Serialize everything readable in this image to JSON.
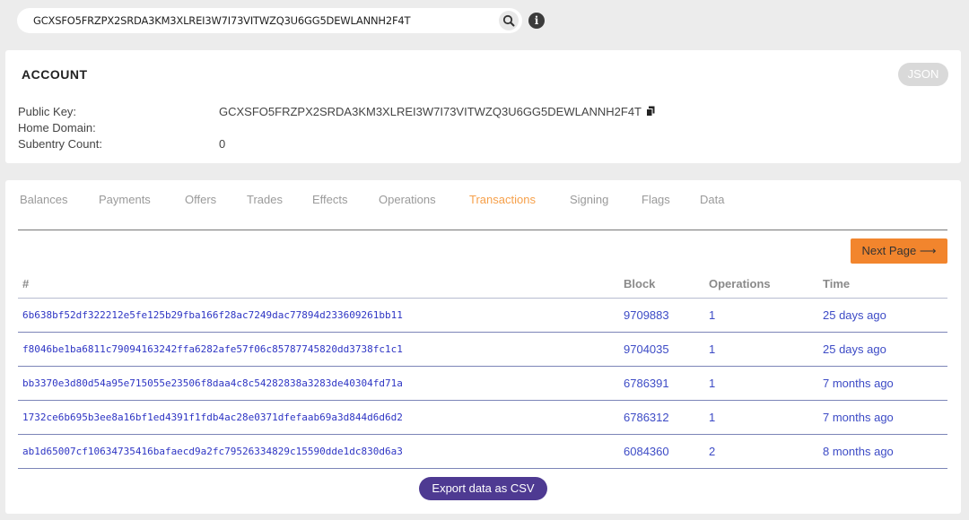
{
  "search": {
    "value": "GCXSFO5FRZPX2SRDA3KM3XLREI3W7I73VITWZQ3U6GG5DEWLANNH2F4T",
    "icon": "search-icon"
  },
  "account": {
    "title": "ACCOUNT",
    "json_label": "JSON",
    "public_key_label": "Public Key:",
    "public_key_value": "GCXSFO5FRZPX2SRDA3KM3XLREI3W7I73VITWZQ3U6GG5DEWLANNH2F4T",
    "home_domain_label": "Home Domain:",
    "home_domain_value": "",
    "subentry_label": "Subentry Count:",
    "subentry_value": "0"
  },
  "tabs": [
    {
      "label": "Balances"
    },
    {
      "label": "Payments"
    },
    {
      "label": "Offers"
    },
    {
      "label": "Trades"
    },
    {
      "label": "Effects"
    },
    {
      "label": "Operations"
    },
    {
      "label": "Transactions",
      "active": true
    },
    {
      "label": "Signing"
    },
    {
      "label": "Flags"
    },
    {
      "label": "Data"
    }
  ],
  "next_page_label": "Next Page ⟶",
  "table": {
    "headers": [
      "#",
      "Block",
      "Operations",
      "Time"
    ],
    "rows": [
      {
        "hash": "6b638bf52df322212e5fe125b29fba166f28ac7249dac77894d233609261bb11",
        "block": "9709883",
        "ops": "1",
        "time": "25 days ago"
      },
      {
        "hash": "f8046be1ba6811c79094163242ffa6282afe57f06c85787745820dd3738fc1c1",
        "block": "9704035",
        "ops": "1",
        "time": "25 days ago"
      },
      {
        "hash": "bb3370e3d80d54a95e715055e23506f8daa4c8c54282838a3283de40304fd71a",
        "block": "6786391",
        "ops": "1",
        "time": "7 months ago"
      },
      {
        "hash": "1732ce6b695b3ee8a16bf1ed4391f1fdb4ac28e0371dfefaab69a3d844d6d6d2",
        "block": "6786312",
        "ops": "1",
        "time": "7 months ago"
      },
      {
        "hash": "ab1d65007cf10634735416bafaecd9a2fc79526334829c15590dde1dc830d6a3",
        "block": "6084360",
        "ops": "2",
        "time": "8 months ago"
      }
    ]
  },
  "export_label": "Export data as CSV",
  "colors": {
    "accent_orange": "#f2852d",
    "active_tab": "#f6a04a",
    "link_blue": "#3d4bc6",
    "export_purple": "#4e3a92"
  }
}
